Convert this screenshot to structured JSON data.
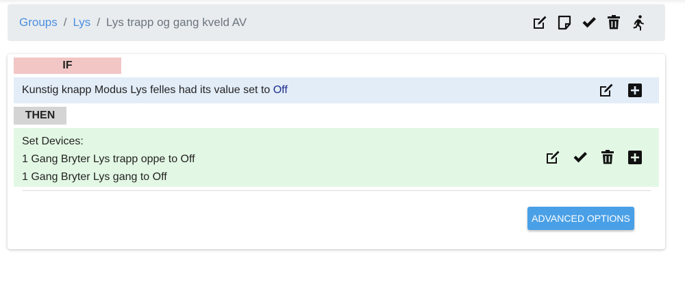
{
  "breadcrumb": {
    "items": [
      {
        "label": "Groups"
      },
      {
        "label": "Lys"
      }
    ],
    "separator": "/",
    "current": "Lys trapp og gang kveld AV"
  },
  "toolbar": {
    "icons": [
      "edit-icon",
      "note-icon",
      "check-icon",
      "trash-icon",
      "run-icon"
    ]
  },
  "rule": {
    "if_label": "IF",
    "condition_text": "Kunstig knapp Modus Lys felles had its value set to",
    "condition_value": "Off",
    "then_label": "THEN",
    "actions_header": "Set Devices:",
    "actions": [
      "1 Gang Bryter Lys trapp oppe to Off",
      "1 Gang Bryter Lys gang to Off"
    ]
  },
  "advanced_button": "ADVANCED OPTIONS",
  "colors": {
    "link": "#4a8fe0",
    "if_label_bg": "#f2c6c5",
    "if_row_bg": "#e3edf8",
    "then_label_bg": "#d4d4d4",
    "then_row_bg": "#e3f8e4",
    "button_bg": "#4aa0e6",
    "condition_value": "#1a2b8c"
  }
}
